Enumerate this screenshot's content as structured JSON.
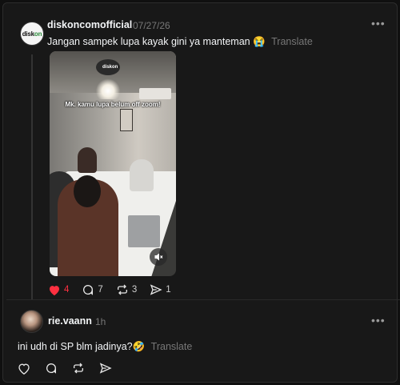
{
  "post": {
    "username": "diskoncomofficial",
    "date": "07/27/26",
    "text": "Jangan sampek lupa kayak gini ya manteman 😭",
    "translate_label": "Translate",
    "avatar_logo": "diskon",
    "media": {
      "caption": "Mk. kamu lupa belum off zoom!",
      "brand": "diskon"
    },
    "actions": {
      "likes": "4",
      "comments": "7",
      "reposts": "3",
      "shares": "1"
    },
    "colors": {
      "like": "#ff3040"
    }
  },
  "reply": {
    "username": "rie.vaann",
    "time": "1h",
    "text": "ini udh di SP blm jadinya?🤣",
    "translate_label": "Translate"
  },
  "icons": {
    "more": "more-horizontal-icon",
    "heart": "heart-icon",
    "comment": "comment-icon",
    "repost": "repost-icon",
    "share": "share-icon",
    "mute": "volume-mute-icon"
  }
}
